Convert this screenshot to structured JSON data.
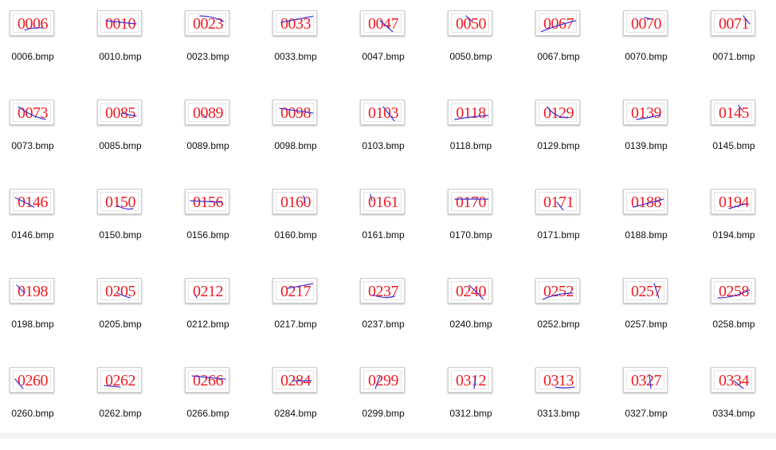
{
  "colors": {
    "captcha_text": "#ee1c24",
    "noise_line": "#3b2fd6",
    "background": "#ffffff",
    "label_text": "#111111"
  },
  "files": [
    {
      "code": "0006",
      "filename": "0006.bmp",
      "icon": "bitmap-thumbnail-icon"
    },
    {
      "code": "0010",
      "filename": "0010.bmp",
      "icon": "bitmap-thumbnail-icon"
    },
    {
      "code": "0023",
      "filename": "0023.bmp",
      "icon": "bitmap-thumbnail-icon"
    },
    {
      "code": "0033",
      "filename": "0033.bmp",
      "icon": "bitmap-thumbnail-icon"
    },
    {
      "code": "0047",
      "filename": "0047.bmp",
      "icon": "bitmap-thumbnail-icon"
    },
    {
      "code": "0050",
      "filename": "0050.bmp",
      "icon": "bitmap-thumbnail-icon"
    },
    {
      "code": "0067",
      "filename": "0067.bmp",
      "icon": "bitmap-thumbnail-icon"
    },
    {
      "code": "0070",
      "filename": "0070.bmp",
      "icon": "bitmap-thumbnail-icon"
    },
    {
      "code": "0071",
      "filename": "0071.bmp",
      "icon": "bitmap-thumbnail-icon"
    },
    {
      "code": "0073",
      "filename": "0073.bmp",
      "icon": "bitmap-thumbnail-icon"
    },
    {
      "code": "0085",
      "filename": "0085.bmp",
      "icon": "bitmap-thumbnail-icon"
    },
    {
      "code": "0089",
      "filename": "0089.bmp",
      "icon": "bitmap-thumbnail-icon"
    },
    {
      "code": "0098",
      "filename": "0098.bmp",
      "icon": "bitmap-thumbnail-icon"
    },
    {
      "code": "0103",
      "filename": "0103.bmp",
      "icon": "bitmap-thumbnail-icon"
    },
    {
      "code": "0118",
      "filename": "0118.bmp",
      "icon": "bitmap-thumbnail-icon"
    },
    {
      "code": "0129",
      "filename": "0129.bmp",
      "icon": "bitmap-thumbnail-icon"
    },
    {
      "code": "0139",
      "filename": "0139.bmp",
      "icon": "bitmap-thumbnail-icon"
    },
    {
      "code": "0145",
      "filename": "0145.bmp",
      "icon": "bitmap-thumbnail-icon"
    },
    {
      "code": "0146",
      "filename": "0146.bmp",
      "icon": "bitmap-thumbnail-icon"
    },
    {
      "code": "0150",
      "filename": "0150.bmp",
      "icon": "bitmap-thumbnail-icon"
    },
    {
      "code": "0156",
      "filename": "0156.bmp",
      "icon": "bitmap-thumbnail-icon"
    },
    {
      "code": "0160",
      "filename": "0160.bmp",
      "icon": "bitmap-thumbnail-icon"
    },
    {
      "code": "0161",
      "filename": "0161.bmp",
      "icon": "bitmap-thumbnail-icon"
    },
    {
      "code": "0170",
      "filename": "0170.bmp",
      "icon": "bitmap-thumbnail-icon"
    },
    {
      "code": "0171",
      "filename": "0171.bmp",
      "icon": "bitmap-thumbnail-icon"
    },
    {
      "code": "0188",
      "filename": "0188.bmp",
      "icon": "bitmap-thumbnail-icon"
    },
    {
      "code": "0194",
      "filename": "0194.bmp",
      "icon": "bitmap-thumbnail-icon"
    },
    {
      "code": "0198",
      "filename": "0198.bmp",
      "icon": "bitmap-thumbnail-icon"
    },
    {
      "code": "0205",
      "filename": "0205.bmp",
      "icon": "bitmap-thumbnail-icon"
    },
    {
      "code": "0212",
      "filename": "0212.bmp",
      "icon": "bitmap-thumbnail-icon"
    },
    {
      "code": "0217",
      "filename": "0217.bmp",
      "icon": "bitmap-thumbnail-icon"
    },
    {
      "code": "0237",
      "filename": "0237.bmp",
      "icon": "bitmap-thumbnail-icon"
    },
    {
      "code": "0240",
      "filename": "0240.bmp",
      "icon": "bitmap-thumbnail-icon"
    },
    {
      "code": "0252",
      "filename": "0252.bmp",
      "icon": "bitmap-thumbnail-icon"
    },
    {
      "code": "0257",
      "filename": "0257.bmp",
      "icon": "bitmap-thumbnail-icon"
    },
    {
      "code": "0258",
      "filename": "0258.bmp",
      "icon": "bitmap-thumbnail-icon"
    },
    {
      "code": "0260",
      "filename": "0260.bmp",
      "icon": "bitmap-thumbnail-icon"
    },
    {
      "code": "0262",
      "filename": "0262.bmp",
      "icon": "bitmap-thumbnail-icon"
    },
    {
      "code": "0266",
      "filename": "0266.bmp",
      "icon": "bitmap-thumbnail-icon"
    },
    {
      "code": "0284",
      "filename": "0284.bmp",
      "icon": "bitmap-thumbnail-icon"
    },
    {
      "code": "0299",
      "filename": "0299.bmp",
      "icon": "bitmap-thumbnail-icon"
    },
    {
      "code": "0312",
      "filename": "0312.bmp",
      "icon": "bitmap-thumbnail-icon"
    },
    {
      "code": "0313",
      "filename": "0313.bmp",
      "icon": "bitmap-thumbnail-icon"
    },
    {
      "code": "0327",
      "filename": "0327.bmp",
      "icon": "bitmap-thumbnail-icon"
    },
    {
      "code": "0334",
      "filename": "0334.bmp",
      "icon": "bitmap-thumbnail-icon"
    }
  ]
}
